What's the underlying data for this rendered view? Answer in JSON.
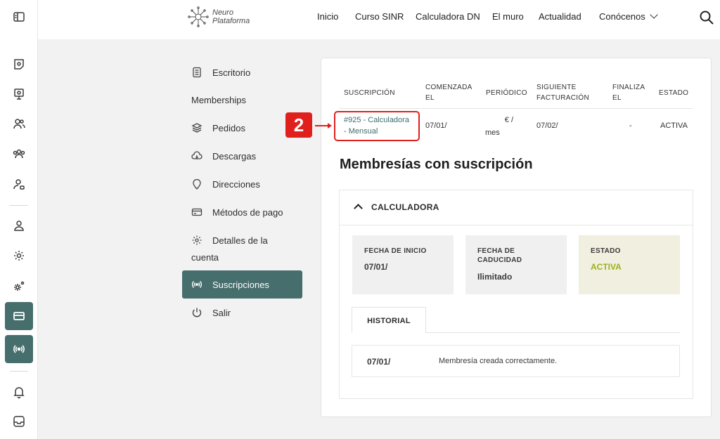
{
  "rail": {
    "icons": [
      "sidebar-toggle-icon",
      "dashboard-icon",
      "presentation-icon",
      "users-icon",
      "group-icon",
      "user-settings-icon",
      "user-icon",
      "gear-icon",
      "gears-icon",
      "card-icon",
      "broadcast-icon",
      "bell-icon",
      "inbox-icon"
    ]
  },
  "header": {
    "logo_line1": "Neuro",
    "logo_line2": "Plataforma",
    "nav": [
      "Inicio",
      "Curso SINR",
      "Calculadora DN",
      "El muro",
      "Actualidad",
      "Conócenos"
    ]
  },
  "account_menu": {
    "items": [
      {
        "label": "Escritorio",
        "icon": "document-icon"
      },
      {
        "label": "Memberships",
        "icon": ""
      },
      {
        "label": "Pedidos",
        "icon": "layers-icon"
      },
      {
        "label": "Descargas",
        "icon": "cloud-download-icon"
      },
      {
        "label": "Direcciones",
        "icon": "location-pin-icon"
      },
      {
        "label": "Métodos de pago",
        "icon": "credit-card-icon"
      },
      {
        "label": "Detalles de la",
        "label2": "cuenta",
        "icon": "gear-icon"
      },
      {
        "label": "Suscripciones",
        "icon": "broadcast-icon"
      },
      {
        "label": "Salir",
        "icon": "power-icon"
      }
    ]
  },
  "subscriptions": {
    "headers": {
      "subscription": "SUSCRIPCIÓN",
      "started_l1": "COMENZADA",
      "started_l2": "EL",
      "period": "PERIÓDICO",
      "next_l1": "SIGUIENTE",
      "next_l2": "FACTURACIÓN",
      "ends_l1": "FINALIZA",
      "ends_l2": "EL",
      "status": "ESTADO"
    },
    "row": {
      "name_l1": "#925 - Calculadora",
      "name_l2": "- Mensual",
      "started": "07/01/",
      "period_l1": "€ /",
      "period_l2": "mes",
      "next": "07/02/",
      "ends": "-",
      "status": "ACTIVA"
    },
    "annotation_number": "2"
  },
  "memberships": {
    "title": "Membresías con suscripción",
    "plan": "CALCULADORA",
    "start_label": "FECHA DE INICIO",
    "start_value": "07/01/",
    "expiry_label_l1": "FECHA DE",
    "expiry_label_l2": "CADUCIDAD",
    "expiry_value": "Ilimitado",
    "status_label": "ESTADO",
    "status_value": "ACTIVA",
    "history_tab": "HISTORIAL",
    "history": [
      {
        "date": "07/01/",
        "message": "Membresía creada correctamente."
      }
    ]
  },
  "colors": {
    "accent": "#466e6c",
    "link": "#3f6e6b",
    "annotation": "#e0201c",
    "status_active": "#9ab31c"
  }
}
